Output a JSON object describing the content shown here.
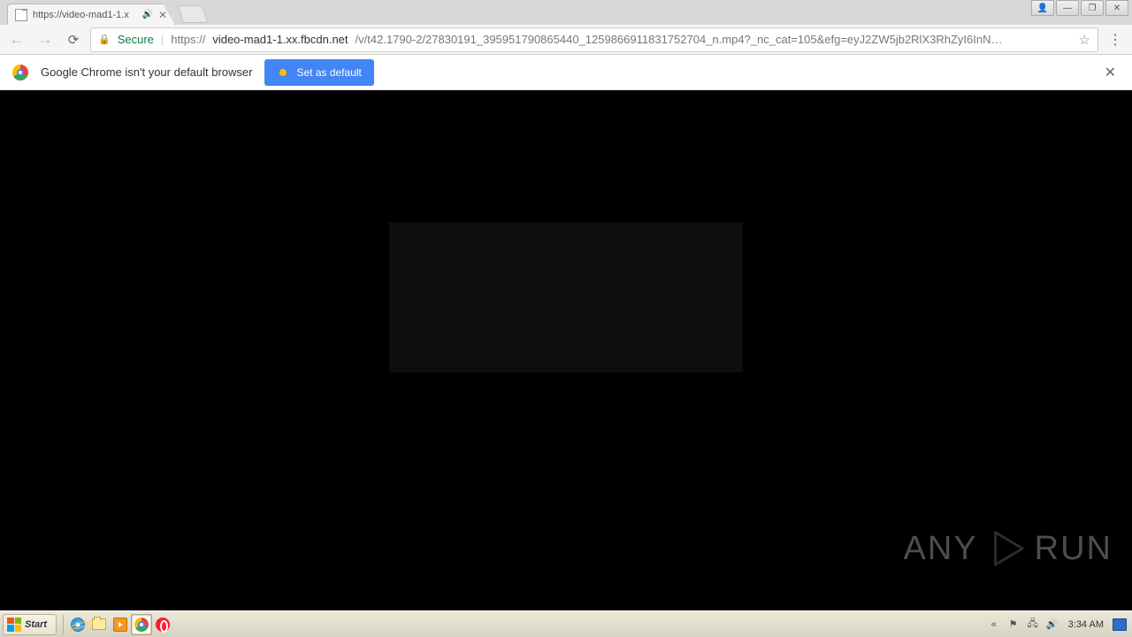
{
  "window_controls": {
    "user": "👤",
    "min": "—",
    "max": "❐",
    "close": "✕"
  },
  "tab": {
    "title": "https://video-mad1-1.x",
    "has_audio": true
  },
  "toolbar": {
    "secure_label": "Secure",
    "url_protocol": "https://",
    "url_host": "video-mad1-1.xx.fbcdn.net",
    "url_path": "/v/t42.1790-2/27830191_395951790865440_1259866911831752704_n.mp4?_nc_cat=105&efg=eyJ2ZW5jb2RlX3RhZyI6InN…"
  },
  "infobar": {
    "message": "Google Chrome isn't your default browser",
    "button": "Set as default"
  },
  "watermark": {
    "left": "ANY",
    "right": "RUN"
  },
  "taskbar": {
    "start": "Start",
    "clock": "3:34 AM"
  }
}
